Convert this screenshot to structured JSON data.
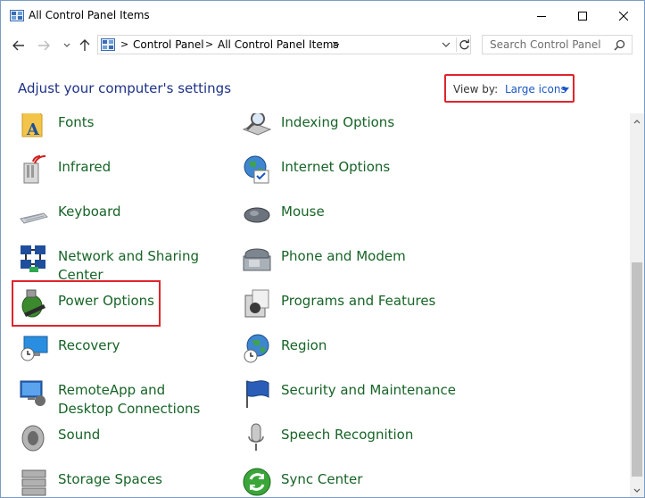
{
  "window": {
    "title": "All Control Panel Items"
  },
  "address": {
    "crumbs": [
      "Control Panel",
      "All Control Panel Items"
    ],
    "separator": ">"
  },
  "search": {
    "placeholder": "Search Control Panel"
  },
  "header": {
    "title": "Adjust your computer's settings"
  },
  "view_by": {
    "label": "View by:",
    "value": "Large icons"
  },
  "items_left": [
    {
      "label": "Fonts",
      "icon": "fonts-icon"
    },
    {
      "label": "Infrared",
      "icon": "infrared-icon"
    },
    {
      "label": "Keyboard",
      "icon": "keyboard-icon"
    },
    {
      "label": "Network and Sharing Center",
      "icon": "network-icon"
    },
    {
      "label": "Power Options",
      "icon": "power-icon"
    },
    {
      "label": "Recovery",
      "icon": "recovery-icon"
    },
    {
      "label": "RemoteApp and Desktop Connections",
      "icon": "remoteapp-icon"
    },
    {
      "label": "Sound",
      "icon": "speaker-icon"
    },
    {
      "label": "Storage Spaces",
      "icon": "storage-icon"
    }
  ],
  "items_right": [
    {
      "label": "Indexing Options",
      "icon": "indexing-icon"
    },
    {
      "label": "Internet Options",
      "icon": "internet-icon"
    },
    {
      "label": "Mouse",
      "icon": "mouse-icon"
    },
    {
      "label": "Phone and Modem",
      "icon": "phone-icon"
    },
    {
      "label": "Programs and Features",
      "icon": "programs-icon"
    },
    {
      "label": "Region",
      "icon": "region-icon"
    },
    {
      "label": "Security and Maintenance",
      "icon": "flag-icon"
    },
    {
      "label": "Speech Recognition",
      "icon": "microphone-icon"
    },
    {
      "label": "Sync Center",
      "icon": "sync-icon"
    }
  ],
  "colors": {
    "link": "#176427",
    "highlight": "#e0242c",
    "heading": "#1e3287",
    "accent": "#1a56c4"
  }
}
